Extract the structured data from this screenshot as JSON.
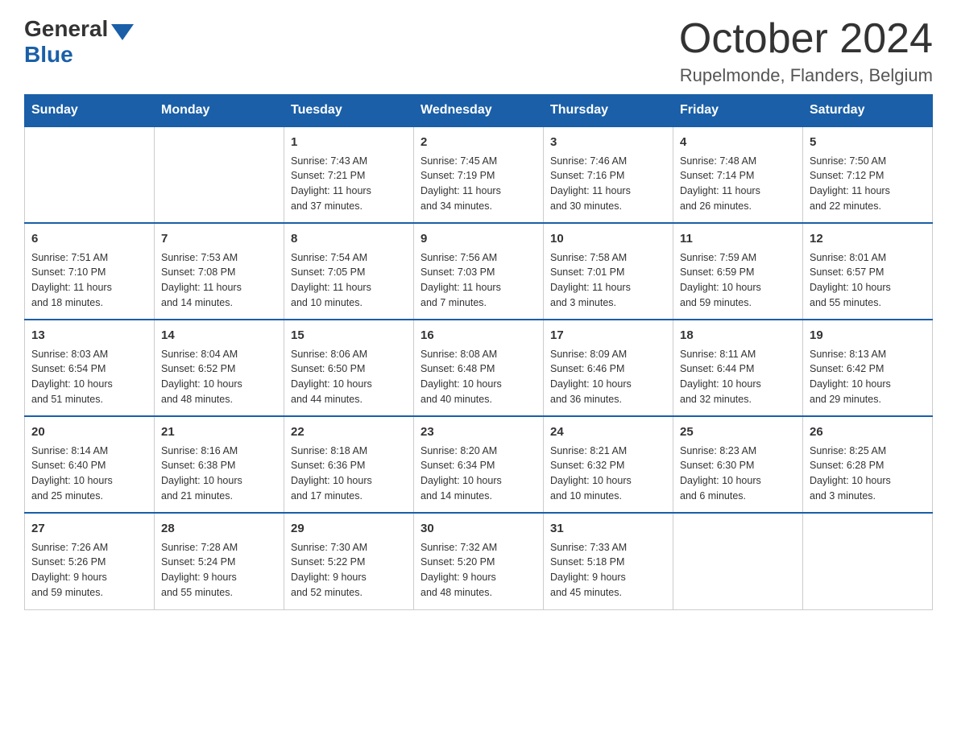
{
  "header": {
    "logo_general": "General",
    "logo_blue": "Blue",
    "month_title": "October 2024",
    "location": "Rupelmonde, Flanders, Belgium"
  },
  "calendar": {
    "days_of_week": [
      "Sunday",
      "Monday",
      "Tuesday",
      "Wednesday",
      "Thursday",
      "Friday",
      "Saturday"
    ],
    "weeks": [
      [
        {
          "day": "",
          "info": ""
        },
        {
          "day": "",
          "info": ""
        },
        {
          "day": "1",
          "info": "Sunrise: 7:43 AM\nSunset: 7:21 PM\nDaylight: 11 hours\nand 37 minutes."
        },
        {
          "day": "2",
          "info": "Sunrise: 7:45 AM\nSunset: 7:19 PM\nDaylight: 11 hours\nand 34 minutes."
        },
        {
          "day": "3",
          "info": "Sunrise: 7:46 AM\nSunset: 7:16 PM\nDaylight: 11 hours\nand 30 minutes."
        },
        {
          "day": "4",
          "info": "Sunrise: 7:48 AM\nSunset: 7:14 PM\nDaylight: 11 hours\nand 26 minutes."
        },
        {
          "day": "5",
          "info": "Sunrise: 7:50 AM\nSunset: 7:12 PM\nDaylight: 11 hours\nand 22 minutes."
        }
      ],
      [
        {
          "day": "6",
          "info": "Sunrise: 7:51 AM\nSunset: 7:10 PM\nDaylight: 11 hours\nand 18 minutes."
        },
        {
          "day": "7",
          "info": "Sunrise: 7:53 AM\nSunset: 7:08 PM\nDaylight: 11 hours\nand 14 minutes."
        },
        {
          "day": "8",
          "info": "Sunrise: 7:54 AM\nSunset: 7:05 PM\nDaylight: 11 hours\nand 10 minutes."
        },
        {
          "day": "9",
          "info": "Sunrise: 7:56 AM\nSunset: 7:03 PM\nDaylight: 11 hours\nand 7 minutes."
        },
        {
          "day": "10",
          "info": "Sunrise: 7:58 AM\nSunset: 7:01 PM\nDaylight: 11 hours\nand 3 minutes."
        },
        {
          "day": "11",
          "info": "Sunrise: 7:59 AM\nSunset: 6:59 PM\nDaylight: 10 hours\nand 59 minutes."
        },
        {
          "day": "12",
          "info": "Sunrise: 8:01 AM\nSunset: 6:57 PM\nDaylight: 10 hours\nand 55 minutes."
        }
      ],
      [
        {
          "day": "13",
          "info": "Sunrise: 8:03 AM\nSunset: 6:54 PM\nDaylight: 10 hours\nand 51 minutes."
        },
        {
          "day": "14",
          "info": "Sunrise: 8:04 AM\nSunset: 6:52 PM\nDaylight: 10 hours\nand 48 minutes."
        },
        {
          "day": "15",
          "info": "Sunrise: 8:06 AM\nSunset: 6:50 PM\nDaylight: 10 hours\nand 44 minutes."
        },
        {
          "day": "16",
          "info": "Sunrise: 8:08 AM\nSunset: 6:48 PM\nDaylight: 10 hours\nand 40 minutes."
        },
        {
          "day": "17",
          "info": "Sunrise: 8:09 AM\nSunset: 6:46 PM\nDaylight: 10 hours\nand 36 minutes."
        },
        {
          "day": "18",
          "info": "Sunrise: 8:11 AM\nSunset: 6:44 PM\nDaylight: 10 hours\nand 32 minutes."
        },
        {
          "day": "19",
          "info": "Sunrise: 8:13 AM\nSunset: 6:42 PM\nDaylight: 10 hours\nand 29 minutes."
        }
      ],
      [
        {
          "day": "20",
          "info": "Sunrise: 8:14 AM\nSunset: 6:40 PM\nDaylight: 10 hours\nand 25 minutes."
        },
        {
          "day": "21",
          "info": "Sunrise: 8:16 AM\nSunset: 6:38 PM\nDaylight: 10 hours\nand 21 minutes."
        },
        {
          "day": "22",
          "info": "Sunrise: 8:18 AM\nSunset: 6:36 PM\nDaylight: 10 hours\nand 17 minutes."
        },
        {
          "day": "23",
          "info": "Sunrise: 8:20 AM\nSunset: 6:34 PM\nDaylight: 10 hours\nand 14 minutes."
        },
        {
          "day": "24",
          "info": "Sunrise: 8:21 AM\nSunset: 6:32 PM\nDaylight: 10 hours\nand 10 minutes."
        },
        {
          "day": "25",
          "info": "Sunrise: 8:23 AM\nSunset: 6:30 PM\nDaylight: 10 hours\nand 6 minutes."
        },
        {
          "day": "26",
          "info": "Sunrise: 8:25 AM\nSunset: 6:28 PM\nDaylight: 10 hours\nand 3 minutes."
        }
      ],
      [
        {
          "day": "27",
          "info": "Sunrise: 7:26 AM\nSunset: 5:26 PM\nDaylight: 9 hours\nand 59 minutes."
        },
        {
          "day": "28",
          "info": "Sunrise: 7:28 AM\nSunset: 5:24 PM\nDaylight: 9 hours\nand 55 minutes."
        },
        {
          "day": "29",
          "info": "Sunrise: 7:30 AM\nSunset: 5:22 PM\nDaylight: 9 hours\nand 52 minutes."
        },
        {
          "day": "30",
          "info": "Sunrise: 7:32 AM\nSunset: 5:20 PM\nDaylight: 9 hours\nand 48 minutes."
        },
        {
          "day": "31",
          "info": "Sunrise: 7:33 AM\nSunset: 5:18 PM\nDaylight: 9 hours\nand 45 minutes."
        },
        {
          "day": "",
          "info": ""
        },
        {
          "day": "",
          "info": ""
        }
      ]
    ]
  }
}
